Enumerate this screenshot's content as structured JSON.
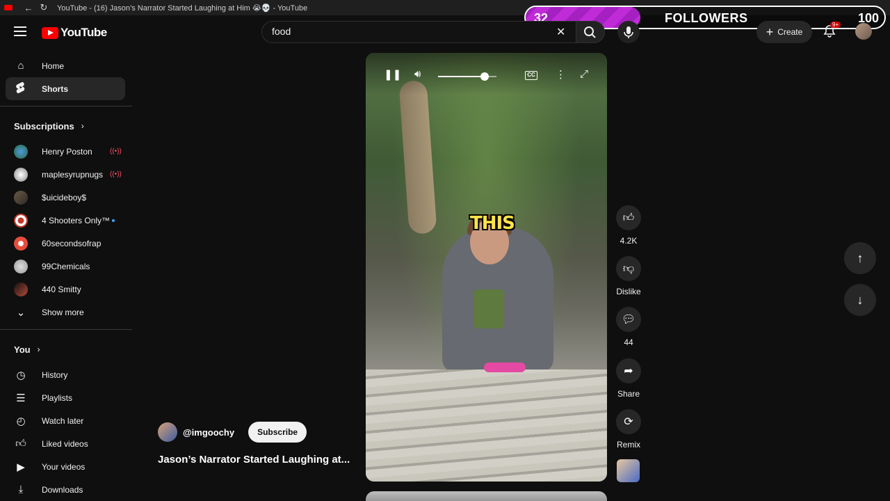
{
  "browser": {
    "tab_title": "YouTube - (16) Jason’s Narrator Started Laughing at Him 😭💀 - YouTube"
  },
  "followers_overlay": {
    "current": "32",
    "label": "FOLLOWERS",
    "goal": "100",
    "progress_fraction": 0.32,
    "fill_color": "#c02bd8"
  },
  "header": {
    "logo_text": "YouTube",
    "search_value": "food",
    "create_label": "Create",
    "notification_badge": "9+"
  },
  "sidebar": {
    "main": [
      {
        "label": "Home",
        "icon": "home-icon"
      },
      {
        "label": "Shorts",
        "icon": "shorts-icon",
        "active": true
      }
    ],
    "subscriptions_title": "Subscriptions",
    "subscriptions": [
      {
        "label": "Henry Poston",
        "status": "live"
      },
      {
        "label": "maplesyrupnugs",
        "status": "live"
      },
      {
        "label": "$uicideboy$",
        "status": ""
      },
      {
        "label": "4 Shooters Only™",
        "status": "new"
      },
      {
        "label": "60secondsofrap",
        "status": ""
      },
      {
        "label": "99Chemicals",
        "status": ""
      },
      {
        "label": "440 Smitty",
        "status": ""
      }
    ],
    "show_more": "Show more",
    "you_title": "You",
    "you_items": [
      {
        "label": "History",
        "icon": "history-icon"
      },
      {
        "label": "Playlists",
        "icon": "playlists-icon"
      },
      {
        "label": "Watch later",
        "icon": "watch-later-icon"
      },
      {
        "label": "Liked videos",
        "icon": "thumbs-up-icon"
      },
      {
        "label": "Your videos",
        "icon": "your-videos-icon"
      },
      {
        "label": "Downloads",
        "icon": "download-icon"
      }
    ]
  },
  "short": {
    "caption": "THIS",
    "channel": "@imgoochy",
    "subscribe_label": "Subscribe",
    "title": "Jason’s Narrator Started Laughing at...",
    "volume_fraction": 0.8,
    "cc_label": "CC"
  },
  "actions": {
    "likes": "4.2K",
    "dislike": "Dislike",
    "comments": "44",
    "share": "Share",
    "remix": "Remix"
  }
}
